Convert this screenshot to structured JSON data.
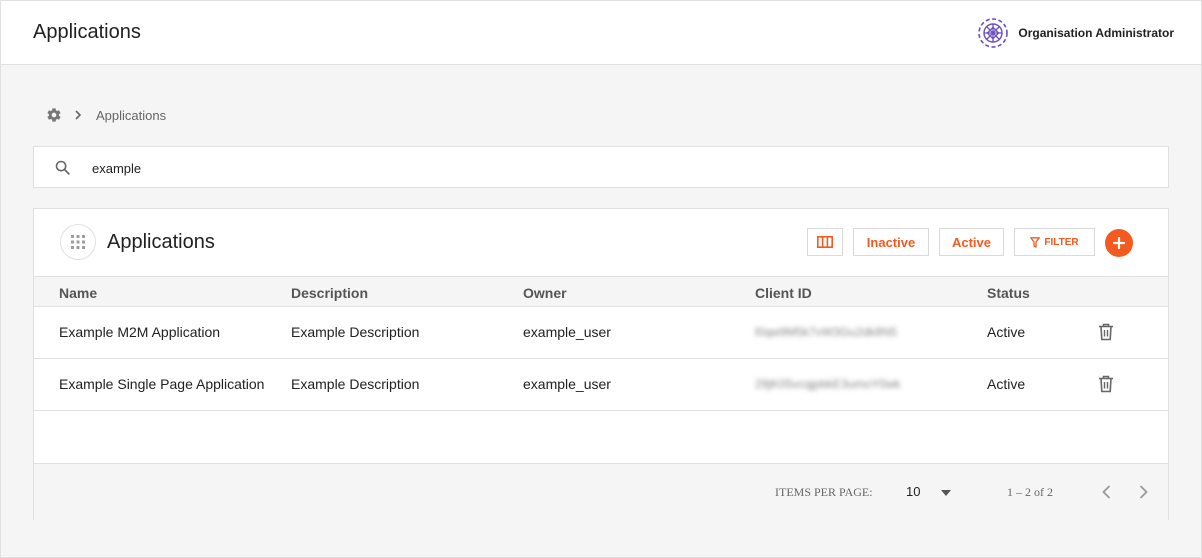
{
  "header": {
    "title": "Applications",
    "user_name": "Organisation Administrator"
  },
  "breadcrumb": {
    "current": "Applications"
  },
  "search": {
    "value": "example"
  },
  "card": {
    "title": "Applications",
    "buttons": {
      "inactive": "Inactive",
      "active": "Active",
      "filter": "FILTER"
    }
  },
  "table": {
    "columns": [
      "Name",
      "Description",
      "Owner",
      "Client ID",
      "Status"
    ],
    "rows": [
      {
        "name": "Example M2M Application",
        "description": "Example Description",
        "owner": "example_user",
        "client_id": "l0qw9M5k7vW3Gu2dk8N5",
        "status": "Active"
      },
      {
        "name": "Example Single Page Application",
        "description": "Example Description",
        "owner": "example_user",
        "client_id": "29jK05vcqjpbkE3umoY0wk",
        "status": "Active"
      }
    ]
  },
  "pagination": {
    "items_per_page_label": "ITEMS PER PAGE:",
    "items_per_page": "10",
    "range": "1 – 2 of 2"
  },
  "colors": {
    "accent": "#f25a1f",
    "logo": "#6b4fbb"
  }
}
